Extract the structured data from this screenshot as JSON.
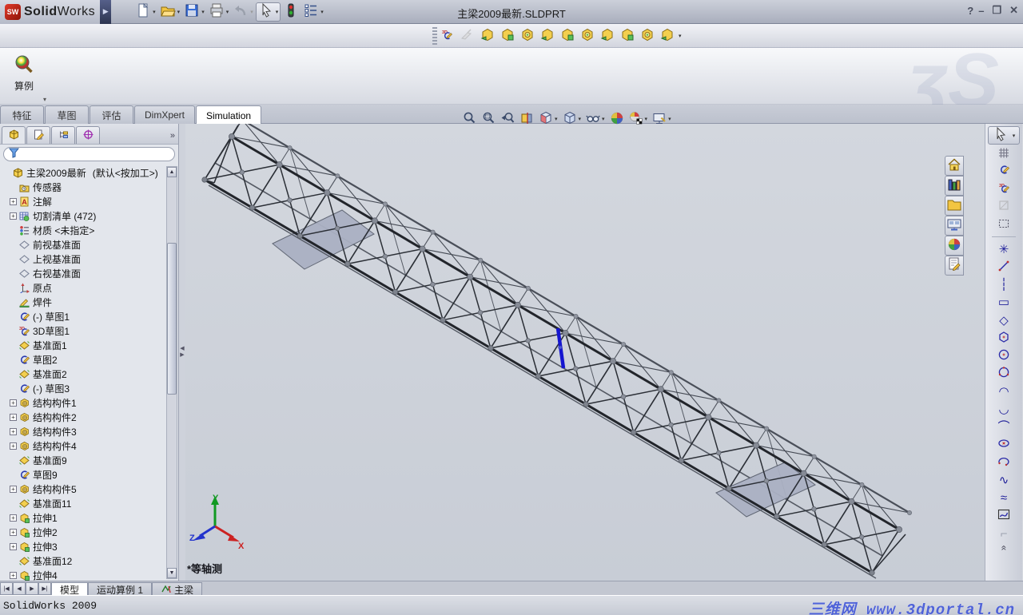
{
  "window": {
    "app_name_bold": "Solid",
    "app_name_light": "Works",
    "title": "主梁2009最新.SLDPRT",
    "controls": [
      {
        "name": "help-button",
        "glyph": "?"
      },
      {
        "name": "minimize-button",
        "glyph": "–"
      },
      {
        "name": "restore-button",
        "glyph": "❐"
      },
      {
        "name": "close-button",
        "glyph": "✕"
      }
    ]
  },
  "main_toolbar": [
    {
      "name": "new-document-button",
      "icon": "new-icon",
      "dropdown": true
    },
    {
      "name": "open-button",
      "icon": "open-icon",
      "dropdown": true
    },
    {
      "name": "save-button",
      "icon": "save-icon",
      "dropdown": true
    },
    {
      "name": "print-button",
      "icon": "print-icon",
      "dropdown": true
    },
    {
      "name": "undo-button",
      "icon": "undo-icon",
      "dropdown": true,
      "disabled": true
    },
    {
      "name": "select-button",
      "icon": "select-icon",
      "dropdown": true,
      "boxed": true
    },
    {
      "name": "performance-button",
      "icon": "traffic-light-icon",
      "dropdown": false
    },
    {
      "name": "options-button",
      "icon": "options-icon",
      "dropdown": true
    }
  ],
  "features_toolbar": [
    {
      "name": "3d-sketch-button",
      "icon": "sketch3d-icon"
    },
    {
      "name": "reference-geometry-button",
      "icon": "ref-geometry-icon",
      "disabled": true
    },
    {
      "name": "structural-member-button",
      "icon": "feat-box-ring-icon"
    },
    {
      "name": "trim-extend-button",
      "icon": "feat-trim-icon"
    },
    {
      "name": "extruded-boss-button",
      "icon": "feat-boss-icon"
    },
    {
      "name": "extruded-cut-button",
      "icon": "feat-cut-icon"
    },
    {
      "name": "end-cap-button",
      "icon": "feat-endcap-icon"
    },
    {
      "name": "gusset-button",
      "icon": "feat-gusset-icon"
    },
    {
      "name": "weld-bead-button",
      "icon": "feat-weld-icon"
    },
    {
      "name": "hole-wizard-button",
      "icon": "feat-hole-icon"
    },
    {
      "name": "chamfer-button",
      "icon": "feat-chamfer-icon"
    },
    {
      "name": "fillet-button",
      "icon": "feat-fillet-icon",
      "dropdown": true
    }
  ],
  "command_manager": {
    "study_button": {
      "label": "算例",
      "icon": "study-magnifier-icon"
    },
    "collapse_glyph": "▾",
    "brand_watermark": "ʒS",
    "tabs": [
      {
        "label": "特征",
        "active": false
      },
      {
        "label": "草图",
        "active": false
      },
      {
        "label": "评估",
        "active": false
      },
      {
        "label": "DimXpert",
        "active": false
      },
      {
        "label": "Simulation",
        "active": true
      }
    ]
  },
  "headsup_toolbar": [
    {
      "name": "zoom-to-fit-button",
      "icon": "zoom-fit-icon"
    },
    {
      "name": "zoom-to-area-button",
      "icon": "zoom-area-icon"
    },
    {
      "name": "previous-view-button",
      "icon": "previous-view-icon"
    },
    {
      "name": "section-view-button",
      "icon": "section-view-icon"
    },
    {
      "name": "view-orientation-button",
      "icon": "view-orientation-icon",
      "dropdown": true
    },
    {
      "name": "display-style-button",
      "icon": "display-style-icon",
      "dropdown": true
    },
    {
      "name": "hide-show-items-button",
      "icon": "glasses-icon",
      "dropdown": true
    },
    {
      "name": "apply-scene-button",
      "icon": "scene-sphere-icon"
    },
    {
      "name": "view-settings-button",
      "icon": "view-settings-icon",
      "dropdown": true
    },
    {
      "name": "edit-appearance-button",
      "icon": "appearance-screen-icon",
      "dropdown": true
    }
  ],
  "feature_tree": {
    "panel_tabs": [
      {
        "name": "featuremanager-tab",
        "icon": "part-icon",
        "active": true
      },
      {
        "name": "propertymanager-tab",
        "icon": "property-icon"
      },
      {
        "name": "configurationmanager-tab",
        "icon": "configuration-icon"
      },
      {
        "name": "dimxpertmanager-tab",
        "icon": "dimxpert-icon"
      }
    ],
    "expand_glyph": "»",
    "filter": {
      "placeholder": "",
      "value": "",
      "icon": "filter-funnel-icon"
    },
    "root": {
      "label": "主梁2009最新",
      "config": "(默认<按加工>)",
      "icon": "part-icon"
    },
    "items": [
      {
        "label": "传感器",
        "icon": "sensors-icon",
        "expandable": false
      },
      {
        "label": "注解",
        "icon": "annotations-icon",
        "expandable": true
      },
      {
        "label": "切割清单 (472)",
        "icon": "cutlist-icon",
        "expandable": true
      },
      {
        "label": "材质 <未指定>",
        "icon": "material-icon",
        "expandable": false
      },
      {
        "label": "前视基准面",
        "icon": "plane-icon",
        "expandable": false
      },
      {
        "label": "上视基准面",
        "icon": "plane-icon",
        "expandable": false
      },
      {
        "label": "右视基准面",
        "icon": "plane-icon",
        "expandable": false
      },
      {
        "label": "原点",
        "icon": "origin-icon",
        "expandable": false
      },
      {
        "label": "焊件",
        "icon": "weldment-icon",
        "expandable": false
      },
      {
        "label": "(-) 草图1",
        "icon": "sketch-icon",
        "expandable": false
      },
      {
        "label": "3D草图1",
        "icon": "sketch3d-icon",
        "expandable": false
      },
      {
        "label": "基准面1",
        "icon": "refplane-icon",
        "expandable": false
      },
      {
        "label": "草图2",
        "icon": "sketch-icon",
        "expandable": false
      },
      {
        "label": "基准面2",
        "icon": "refplane-icon",
        "expandable": false
      },
      {
        "label": "(-) 草图3",
        "icon": "sketch-icon",
        "expandable": false
      },
      {
        "label": "结构构件1",
        "icon": "structmember-icon",
        "expandable": true
      },
      {
        "label": "结构构件2",
        "icon": "structmember-icon",
        "expandable": true
      },
      {
        "label": "结构构件3",
        "icon": "structmember-icon",
        "expandable": true
      },
      {
        "label": "结构构件4",
        "icon": "structmember-icon",
        "expandable": true
      },
      {
        "label": "基准面9",
        "icon": "refplane-icon",
        "expandable": false
      },
      {
        "label": "草图9",
        "icon": "sketch-icon",
        "expandable": false
      },
      {
        "label": "结构构件5",
        "icon": "structmember-icon",
        "expandable": true
      },
      {
        "label": "基准面11",
        "icon": "refplane-icon",
        "expandable": false
      },
      {
        "label": "拉伸1",
        "icon": "extrude-icon",
        "expandable": true
      },
      {
        "label": "拉伸2",
        "icon": "extrude-icon",
        "expandable": true
      },
      {
        "label": "拉伸3",
        "icon": "extrude-icon",
        "expandable": true
      },
      {
        "label": "基准面12",
        "icon": "refplane-icon",
        "expandable": false
      },
      {
        "label": "拉伸4",
        "icon": "extrude-icon",
        "expandable": true
      }
    ]
  },
  "task_pane": [
    {
      "name": "solidworks-resources-tab",
      "icon": "home-icon"
    },
    {
      "name": "design-library-tab",
      "icon": "library-icon"
    },
    {
      "name": "file-explorer-tab",
      "icon": "folder-icon"
    },
    {
      "name": "view-palette-tab",
      "icon": "palette-icon"
    },
    {
      "name": "appearances-scenes-tab",
      "icon": "scene-sphere-icon"
    },
    {
      "name": "custom-properties-tab",
      "icon": "custom-properties-icon"
    }
  ],
  "sketch_toolbar": [
    {
      "name": "select-tool",
      "icon": "select-icon",
      "kind": "select",
      "dropdown": true
    },
    {
      "name": "grid-tool",
      "icon": "grid-icon",
      "kind": "svg"
    },
    {
      "name": "sketch-tool",
      "icon": "sketch-icon",
      "kind": "tree"
    },
    {
      "name": "3d-sketch-tool",
      "icon": "sketch3d-icon",
      "kind": "tree"
    },
    {
      "name": "convert-entities-tool",
      "icon": "convert-icon",
      "kind": "svg",
      "disabled": true
    },
    {
      "name": "box-selection-tool",
      "icon": "dashed-box-icon",
      "kind": "svg"
    },
    {
      "name": "divider",
      "kind": "divider"
    },
    {
      "name": "point-tool",
      "icon": "point-icon",
      "kind": "glyph",
      "glyph": "✳"
    },
    {
      "name": "line-tool",
      "icon": "line-icon",
      "kind": "svg"
    },
    {
      "name": "centerline-tool",
      "icon": "centerline-icon",
      "kind": "glyph",
      "glyph": "┆"
    },
    {
      "name": "corner-rectangle-tool",
      "icon": "rectangle-icon",
      "kind": "glyph",
      "glyph": "▭"
    },
    {
      "name": "parallelogram-tool",
      "icon": "parallelogram-icon",
      "kind": "glyph",
      "glyph": "◇"
    },
    {
      "name": "polygon-tool",
      "icon": "polygon-icon",
      "kind": "svg"
    },
    {
      "name": "circle-tool",
      "icon": "circle-icon",
      "kind": "svg"
    },
    {
      "name": "perimeter-circle-tool",
      "icon": "perimeter-circle-icon",
      "kind": "svg"
    },
    {
      "name": "centerpoint-arc-tool",
      "icon": "centerpoint-arc-icon",
      "kind": "glyph",
      "glyph": "◠"
    },
    {
      "name": "tangent-arc-tool",
      "icon": "tangent-arc-icon",
      "kind": "glyph",
      "glyph": "◡"
    },
    {
      "name": "three-point-arc-tool",
      "icon": "three-point-arc-icon",
      "kind": "glyph",
      "glyph": "⌒"
    },
    {
      "name": "ellipse-tool",
      "icon": "ellipse-icon",
      "kind": "svg"
    },
    {
      "name": "partial-ellipse-tool",
      "icon": "partial-ellipse-icon",
      "kind": "svg"
    },
    {
      "name": "spline-tool",
      "icon": "spline-icon",
      "kind": "glyph",
      "glyph": "∿"
    },
    {
      "name": "spline-2-tool",
      "icon": "spline2-icon",
      "kind": "glyph",
      "glyph": "≈"
    },
    {
      "name": "spline-on-surface-tool",
      "icon": "boxed-spline-icon",
      "kind": "svg"
    },
    {
      "name": "smart-dimension-tool",
      "icon": "dimension-icon",
      "kind": "glyph",
      "glyph": "⌐",
      "disabled": true
    }
  ],
  "sketch_toolbar_more_glyph": "«",
  "viewport": {
    "view_label": "*等轴测",
    "triad": {
      "x": "X",
      "y": "Y",
      "z": "Z"
    },
    "axis_colors": {
      "x": "#cc2222",
      "y": "#119922",
      "z": "#2233cc"
    },
    "selection_color": "#1515d0",
    "background": "#ccd1d9"
  },
  "bottom_bar": {
    "nav": [
      {
        "name": "first-sheet-button",
        "glyph": "|◀"
      },
      {
        "name": "prev-sheet-button",
        "glyph": "◀"
      },
      {
        "name": "next-sheet-button",
        "glyph": "▶"
      },
      {
        "name": "last-sheet-button",
        "glyph": "▶|"
      }
    ],
    "tabs": [
      {
        "label": "模型",
        "active": true,
        "icon": null
      },
      {
        "label": "运动算例 1",
        "active": false,
        "icon": null
      },
      {
        "label": "主梁",
        "active": false,
        "icon": "motion-study-icon"
      }
    ]
  },
  "status_bar": {
    "left_text": "SolidWorks 2009",
    "watermark": "三维网 www.3dportal.cn"
  }
}
